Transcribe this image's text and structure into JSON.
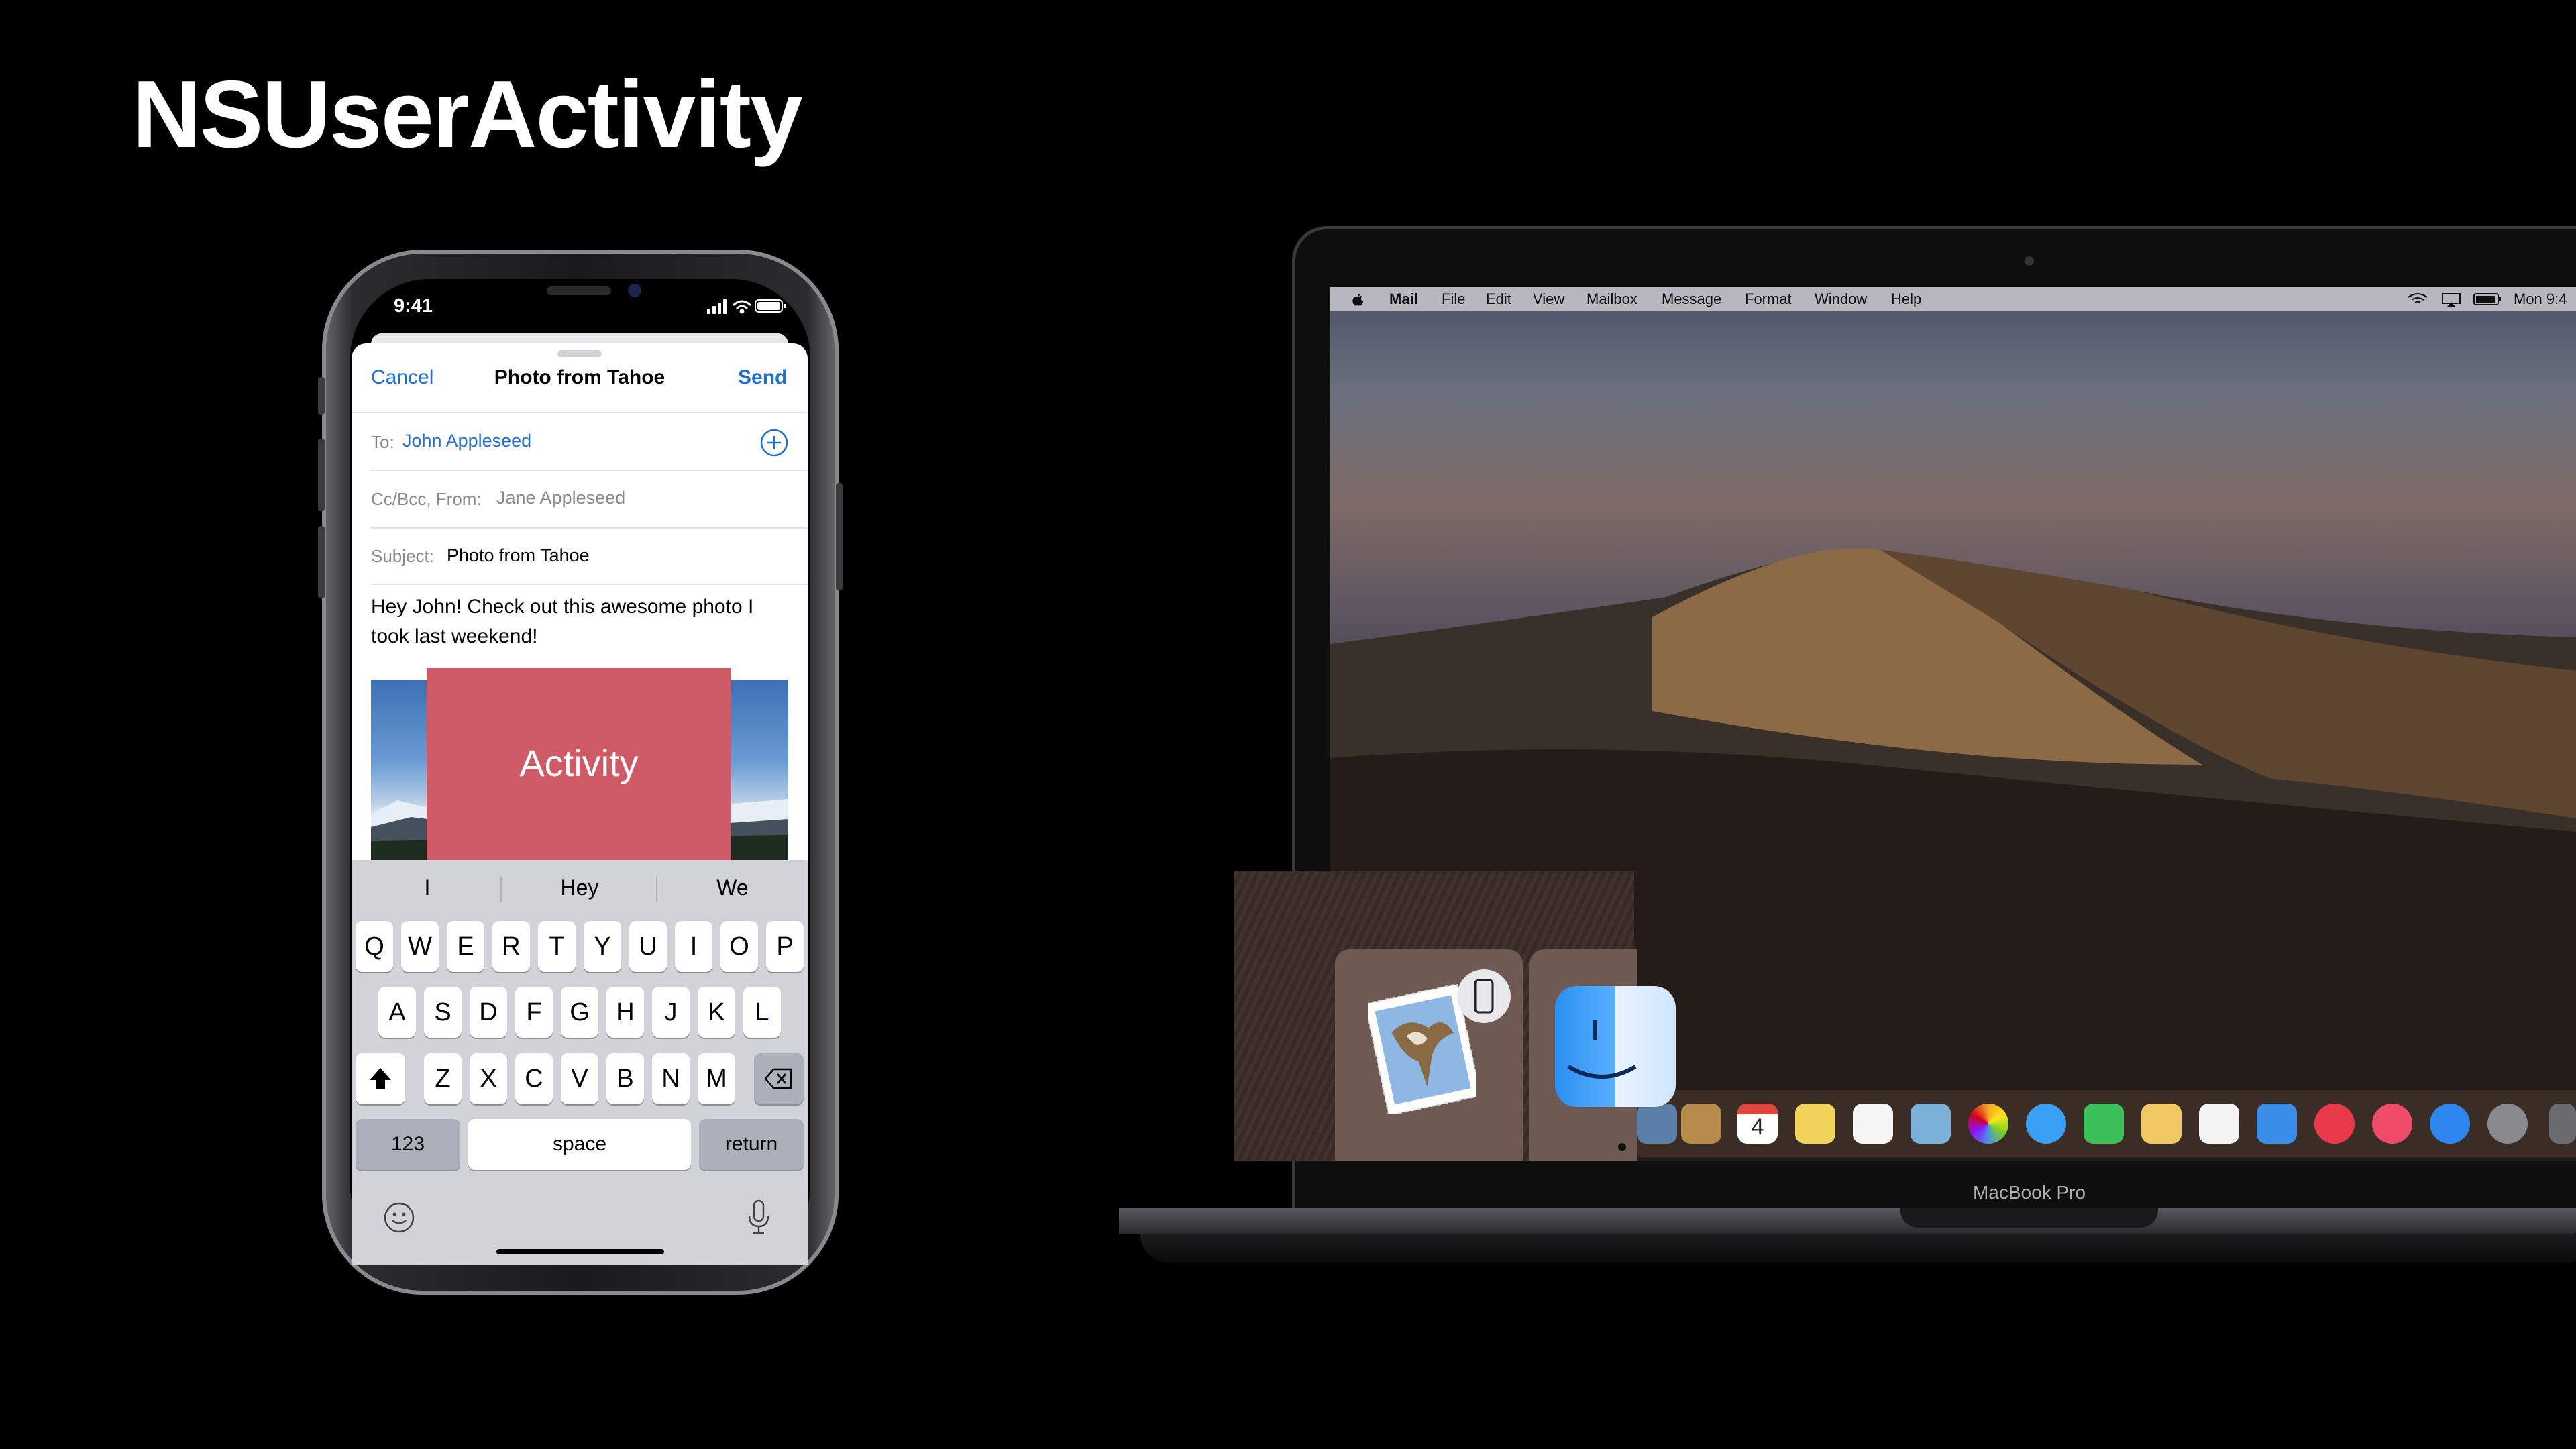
{
  "slide": {
    "title": "NSUserActivity"
  },
  "iphone": {
    "status_time": "9:41",
    "compose": {
      "cancel": "Cancel",
      "title": "Photo from Tahoe",
      "send": "Send",
      "to_label": "To:",
      "to_value": "John Appleseed",
      "ccbcc_label": "Cc/Bcc, From:",
      "ccbcc_value": "Jane Appleseed",
      "subject_label": "Subject:",
      "subject_value": "Photo from Tahoe",
      "body_line1": "Hey John! Check out this awesome photo I",
      "body_line2": "took last weekend!"
    },
    "overlay_label": "Activity",
    "keyboard": {
      "suggestions": [
        "I",
        "Hey",
        "We"
      ],
      "row1": [
        "Q",
        "W",
        "E",
        "R",
        "T",
        "Y",
        "U",
        "I",
        "O",
        "P"
      ],
      "row2": [
        "A",
        "S",
        "D",
        "F",
        "G",
        "H",
        "J",
        "K",
        "L"
      ],
      "row3": [
        "Z",
        "X",
        "C",
        "V",
        "B",
        "N",
        "M"
      ],
      "numbers_key": "123",
      "space_key": "space",
      "return_key": "return"
    }
  },
  "macbook": {
    "menubar": {
      "app": "Mail",
      "items": [
        "File",
        "Edit",
        "View",
        "Mailbox",
        "Message",
        "Format",
        "Window",
        "Help"
      ],
      "clock": "Mon 9:4"
    },
    "model_label": "MacBook Pro",
    "calendar_day": "4"
  },
  "colors": {
    "activity": "#cd5a65",
    "ios_blue": "#1f6fd0",
    "background": "#000000"
  }
}
